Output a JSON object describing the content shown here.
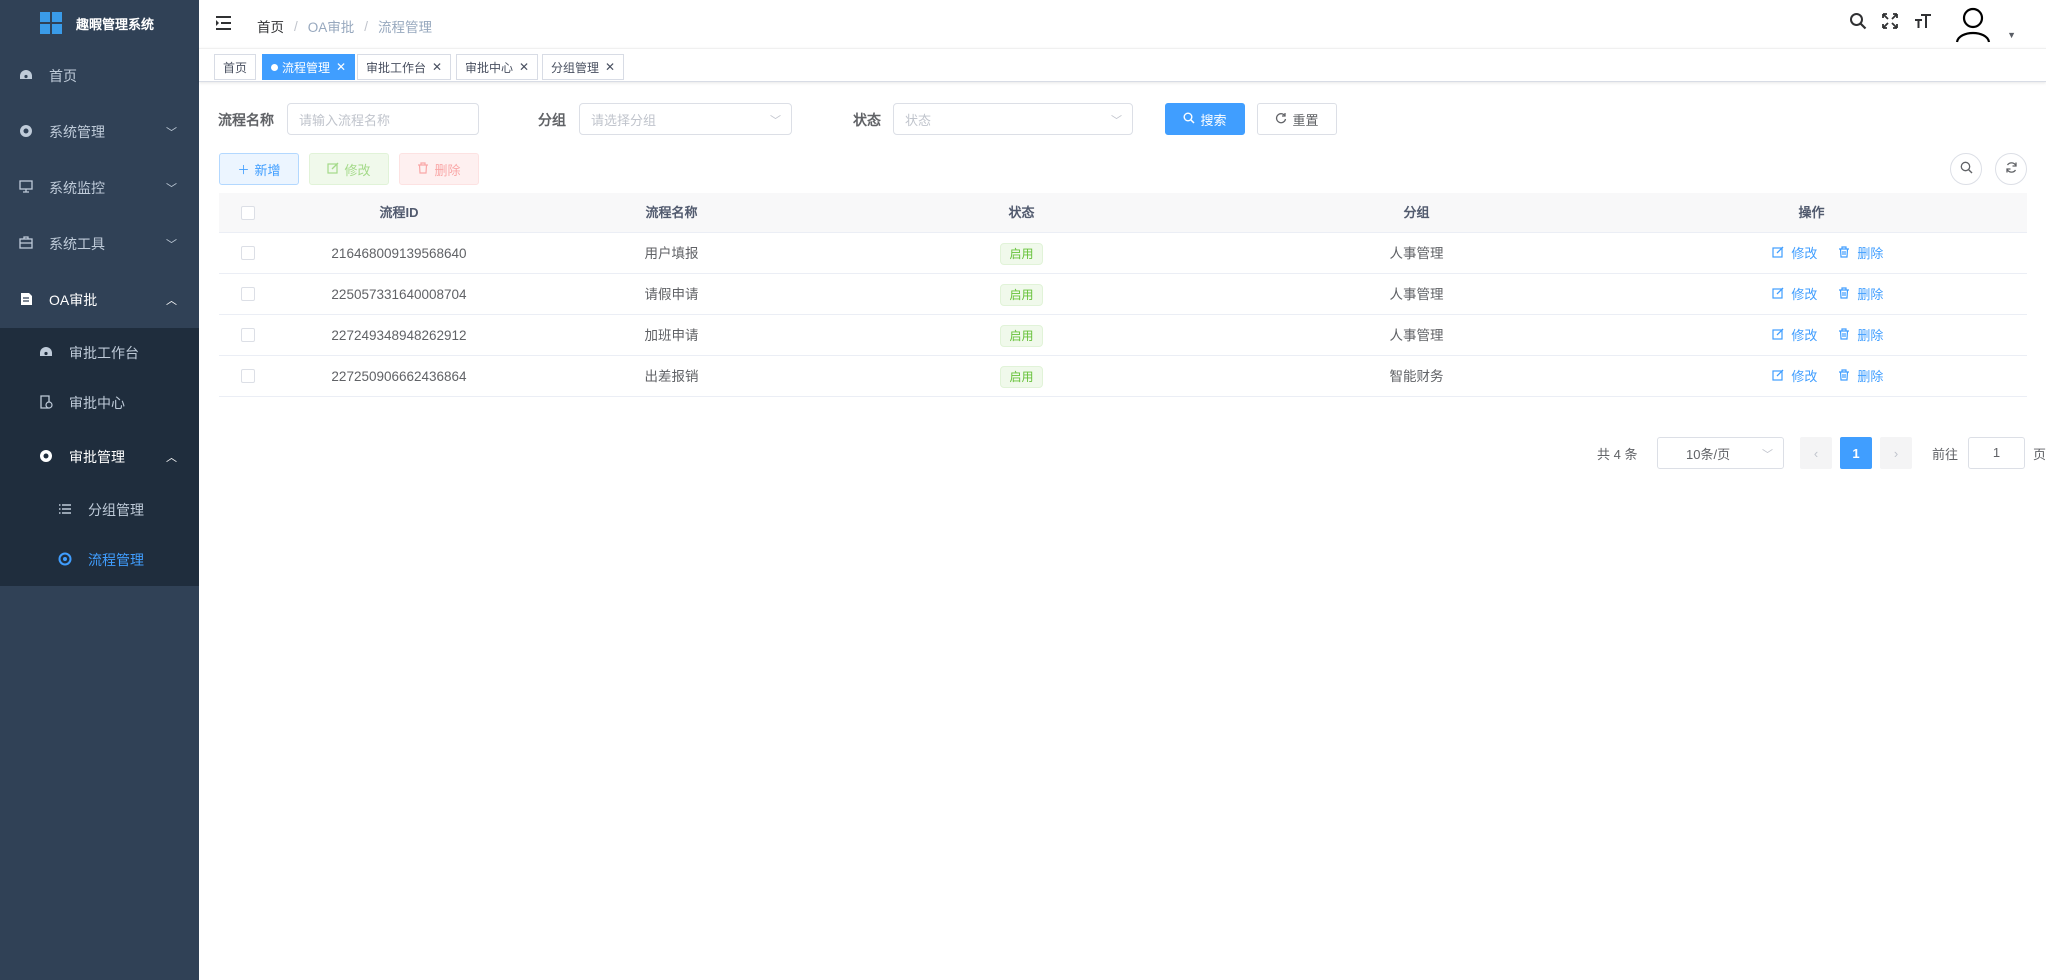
{
  "app": {
    "title": "趣暇管理系统"
  },
  "sidebar": {
    "items": [
      {
        "label": "首页",
        "icon": "dashboard-icon"
      },
      {
        "label": "系统管理",
        "icon": "system-icon"
      },
      {
        "label": "系统监控",
        "icon": "monitor-icon"
      },
      {
        "label": "系统工具",
        "icon": "tool-icon"
      },
      {
        "label": "OA审批",
        "icon": "document-icon"
      }
    ],
    "oa_children": [
      {
        "label": "审批工作台",
        "icon": "dashboard-icon"
      },
      {
        "label": "审批中心",
        "icon": "approve-icon"
      },
      {
        "label": "审批管理",
        "icon": "gear-icon"
      }
    ],
    "manage_children": [
      {
        "label": "分组管理",
        "icon": "list-icon"
      },
      {
        "label": "流程管理",
        "icon": "flow-icon"
      }
    ]
  },
  "breadcrumb": [
    "首页",
    "OA审批",
    "流程管理"
  ],
  "tags": [
    "首页",
    "流程管理",
    "审批工作台",
    "审批中心",
    "分组管理"
  ],
  "search": {
    "name_label": "流程名称",
    "name_placeholder": "请输入流程名称",
    "group_label": "分组",
    "group_placeholder": "请选择分组",
    "status_label": "状态",
    "status_placeholder": "状态",
    "search_btn": "搜索",
    "reset_btn": "重置"
  },
  "toolbar": {
    "add": "新增",
    "edit": "修改",
    "delete": "删除"
  },
  "table": {
    "columns": [
      "流程ID",
      "流程名称",
      "状态",
      "分组",
      "操作"
    ],
    "rows": [
      {
        "id": "216468009139568640",
        "name": "用户填报",
        "status": "启用",
        "group": "人事管理"
      },
      {
        "id": "225057331640008704",
        "name": "请假申请",
        "status": "启用",
        "group": "人事管理"
      },
      {
        "id": "227249348948262912",
        "name": "加班申请",
        "status": "启用",
        "group": "人事管理"
      },
      {
        "id": "227250906662436864",
        "name": "出差报销",
        "status": "启用",
        "group": "智能财务"
      }
    ],
    "edit_label": "修改",
    "delete_label": "删除"
  },
  "pagination": {
    "total_text": "共 4 条",
    "page_size": "10条/页",
    "current_page": "1",
    "goto_label": "前往",
    "goto_value": "1",
    "page_suffix": "页"
  },
  "colors": {
    "sidebar_bg": "#304156",
    "submenu_bg": "#1f2d3d",
    "primary": "#409eff",
    "success": "#67c23a"
  }
}
